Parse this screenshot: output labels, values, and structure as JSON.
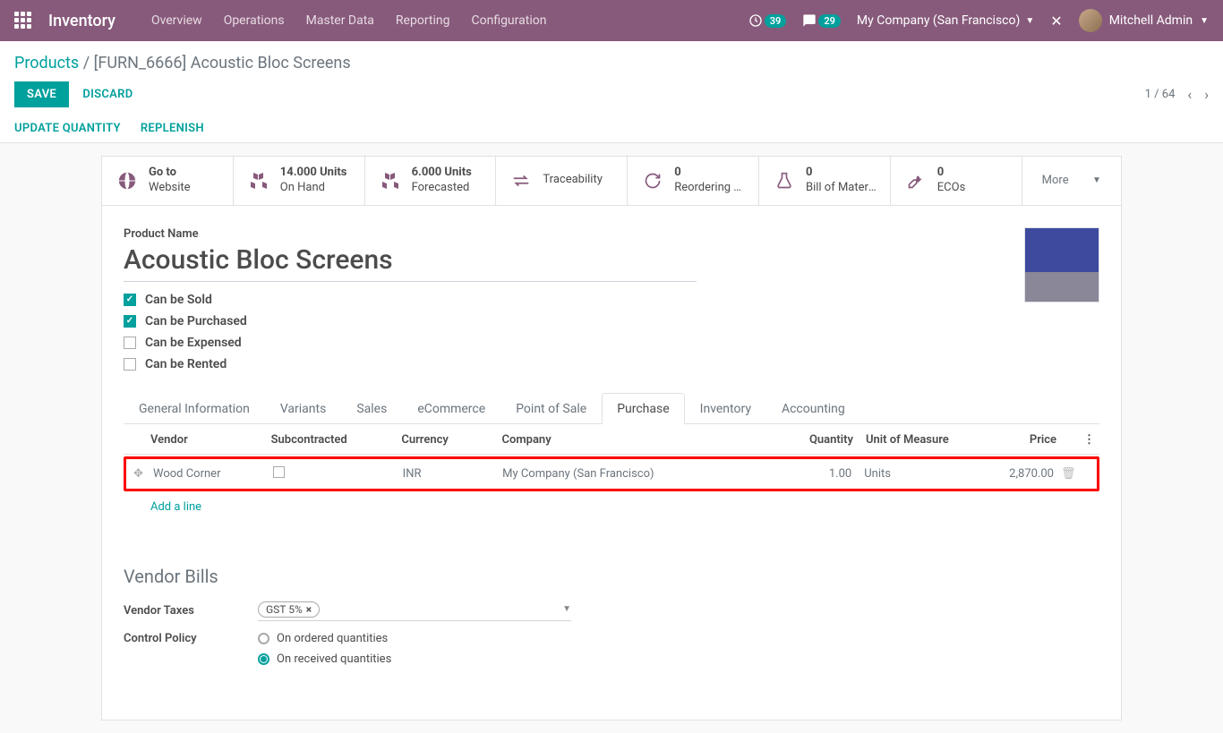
{
  "nav": {
    "brand": "Inventory",
    "menu": [
      "Overview",
      "Operations",
      "Master Data",
      "Reporting",
      "Configuration"
    ],
    "badge1": "39",
    "badge2": "29",
    "company": "My Company (San Francisco)",
    "user": "Mitchell Admin"
  },
  "breadcrumb": {
    "root": "Products",
    "current": "[FURN_6666] Acoustic Bloc Screens"
  },
  "buttons": {
    "save": "SAVE",
    "discard": "DISCARD"
  },
  "pager": {
    "pos": "1 / 64"
  },
  "subactions": {
    "uq": "UPDATE QUANTITY",
    "rep": "REPLENISH"
  },
  "stats": [
    {
      "val": "Go to",
      "lbl": "Website"
    },
    {
      "val": "14.000 Units",
      "lbl": "On Hand"
    },
    {
      "val": "6.000 Units",
      "lbl": "Forecasted"
    },
    {
      "val": "",
      "lbl": "Traceability"
    },
    {
      "val": "0",
      "lbl": "Reordering R..."
    },
    {
      "val": "0",
      "lbl": "Bill of Materi..."
    },
    {
      "val": "0",
      "lbl": "ECOs"
    }
  ],
  "more": "More",
  "product": {
    "label": "Product Name",
    "name": "Acoustic Bloc Screens"
  },
  "checks": [
    {
      "label": "Can be Sold",
      "on": true
    },
    {
      "label": "Can be Purchased",
      "on": true
    },
    {
      "label": "Can be Expensed",
      "on": false
    },
    {
      "label": "Can be Rented",
      "on": false
    }
  ],
  "tabs": [
    "General Information",
    "Variants",
    "Sales",
    "eCommerce",
    "Point of Sale",
    "Purchase",
    "Inventory",
    "Accounting"
  ],
  "active_tab": "Purchase",
  "thead": {
    "vendor": "Vendor",
    "sub": "Subcontracted",
    "cur": "Currency",
    "comp": "Company",
    "qty": "Quantity",
    "uom": "Unit of Measure",
    "price": "Price"
  },
  "rows": [
    {
      "vendor": "Wood Corner",
      "sub": false,
      "cur": "INR",
      "comp": "My Company (San Francisco)",
      "qty": "1.00",
      "uom": "Units",
      "price": "2,870.00"
    }
  ],
  "addline": "Add a line",
  "vendor_bills": {
    "title": "Vendor Bills",
    "taxes_label": "Vendor Taxes",
    "tax": "GST 5%",
    "policy_label": "Control Policy",
    "policy_opts": [
      "On ordered quantities",
      "On received quantities"
    ],
    "policy_sel": 1
  }
}
